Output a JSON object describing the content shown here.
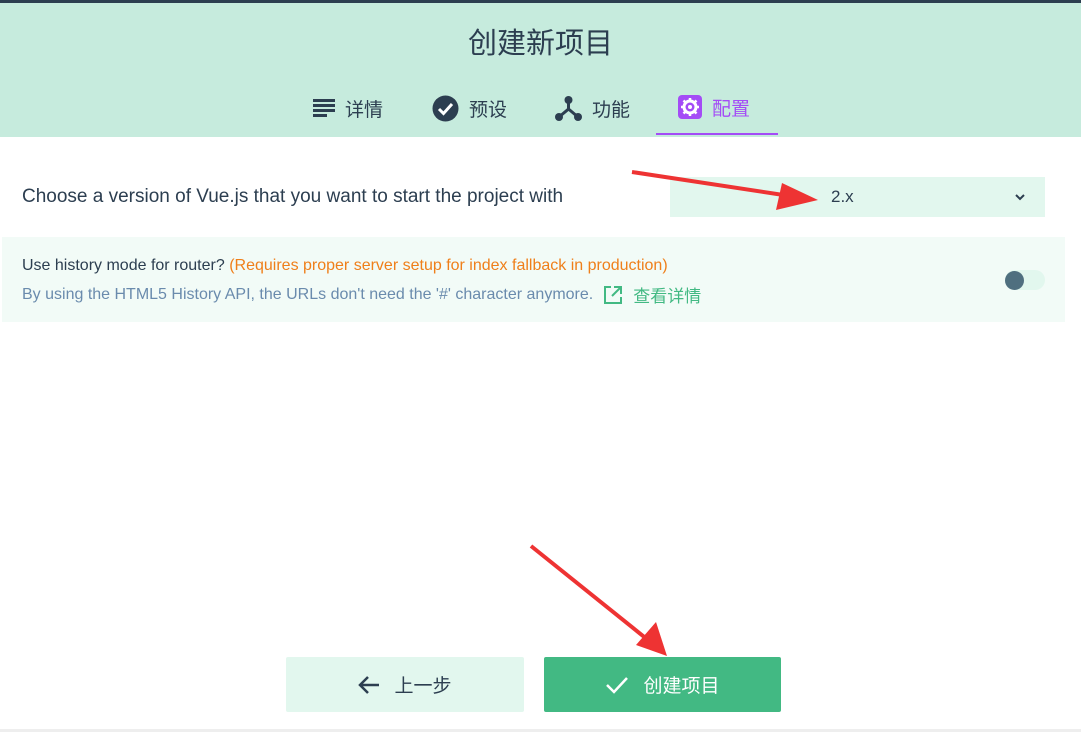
{
  "header": {
    "title": "创建新项目",
    "tabs": [
      {
        "label": "详情",
        "icon": "list-icon"
      },
      {
        "label": "预设",
        "icon": "check-circle-icon"
      },
      {
        "label": "功能",
        "icon": "fork-icon"
      },
      {
        "label": "配置",
        "icon": "gear-icon",
        "active": true
      }
    ]
  },
  "prompts": {
    "vue_version": {
      "question": "Choose a version of Vue.js that you want to start the project with",
      "selected": "2.x"
    },
    "history_mode": {
      "question": "Use history mode for router?",
      "warning": "(Requires proper server setup for index fallback in production)",
      "description": "By using the HTML5 History API, the URLs don't need the '#' character anymore.",
      "more_label": "查看详情",
      "enabled": false
    }
  },
  "footer": {
    "prev_label": "上一步",
    "create_label": "创建项目"
  },
  "colors": {
    "header_bg": "#c6ebdd",
    "accent_green": "#42b983",
    "active_tab": "#a44cf6",
    "warning": "#ef7f1a",
    "annotation_arrow": "#ee3333"
  }
}
